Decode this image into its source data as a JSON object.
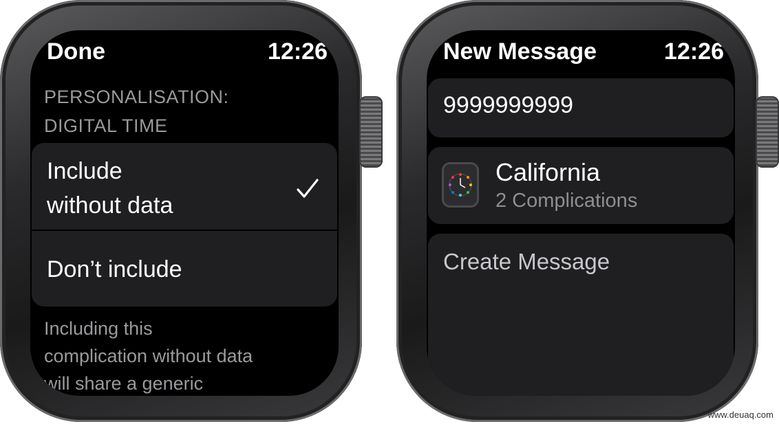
{
  "left_watch": {
    "title": "Done",
    "time": "12:26",
    "section_header_line1": "PERSONALISATION:",
    "section_header_line2": "DIGITAL TIME",
    "option1_line1": "Include",
    "option1_line2": "without data",
    "option1_selected_icon": "checkmark-icon",
    "option2_label": "Don’t include",
    "footer_line1": "Including this",
    "footer_line2": "complication without data",
    "footer_line3": "will share a generic"
  },
  "right_watch": {
    "title": "New Message",
    "time": "12:26",
    "recipient": "9999999999",
    "face_name": "California",
    "face_detail": "2 Complications",
    "face_icon": "watch-face-icon",
    "create_message_placeholder": "Create Message"
  },
  "watermark": "www.deuaq.com"
}
